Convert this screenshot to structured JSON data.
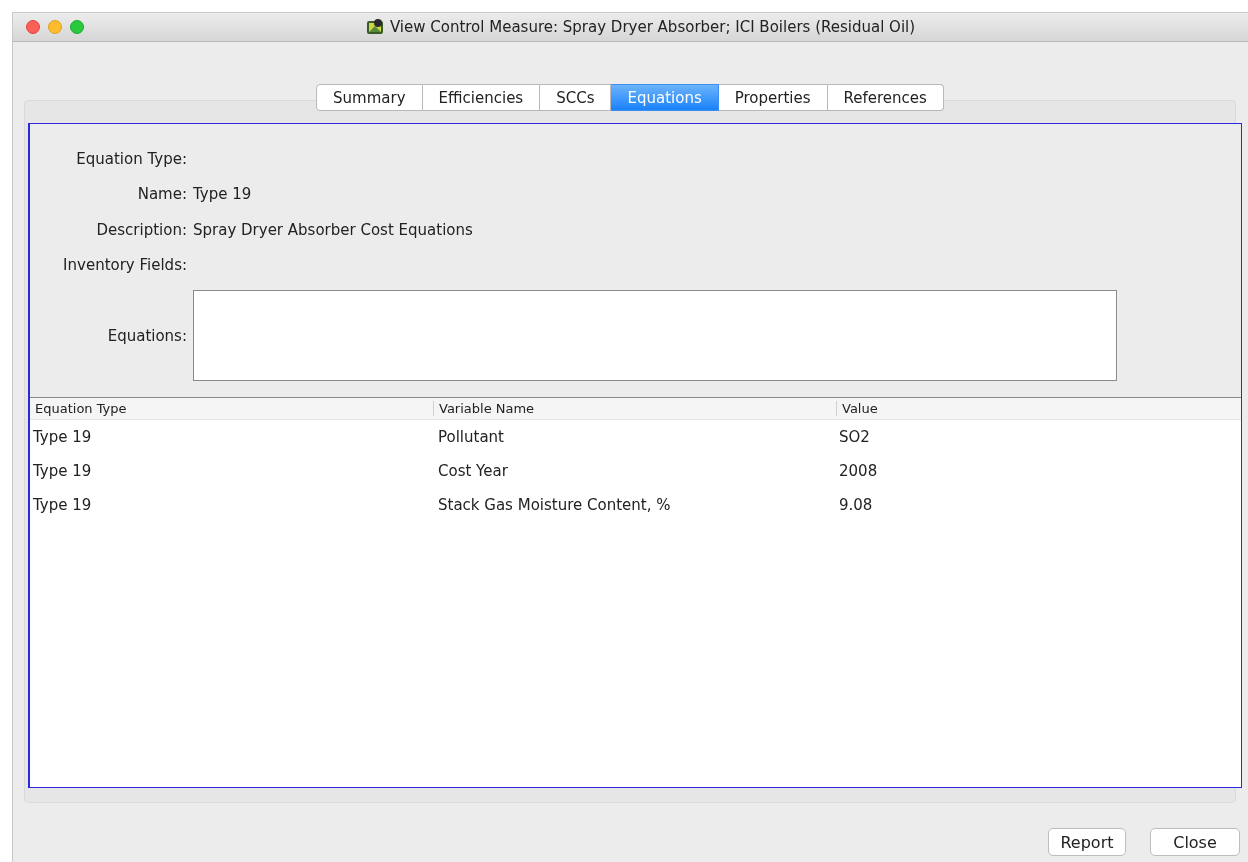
{
  "window": {
    "title": "View Control Measure: Spray Dryer Absorber; ICI Boilers (Residual Oil)"
  },
  "tabs": [
    {
      "label": "Summary",
      "selected": false
    },
    {
      "label": "Efficiencies",
      "selected": false
    },
    {
      "label": "SCCs",
      "selected": false
    },
    {
      "label": "Equations",
      "selected": true
    },
    {
      "label": "Properties",
      "selected": false
    },
    {
      "label": "References",
      "selected": false
    }
  ],
  "form": {
    "fields": [
      {
        "label": "Equation Type:"
      },
      {
        "label": "Name:",
        "value": "Type 19"
      },
      {
        "label": "Description:",
        "value": "Spray Dryer Absorber Cost Equations"
      },
      {
        "label": "Inventory Fields:"
      }
    ],
    "equations": {
      "label": "Equations:"
    }
  },
  "table": {
    "columns": [
      "Equation Type",
      "Variable Name",
      "Value"
    ],
    "rows": [
      [
        "Type 19",
        "Pollutant",
        "SO2"
      ],
      [
        "Type 19",
        "Cost Year",
        "2008"
      ],
      [
        "Type 19",
        "Stack Gas Moisture Content, %",
        "9.08"
      ]
    ]
  },
  "buttons": [
    "Report",
    "Close"
  ]
}
